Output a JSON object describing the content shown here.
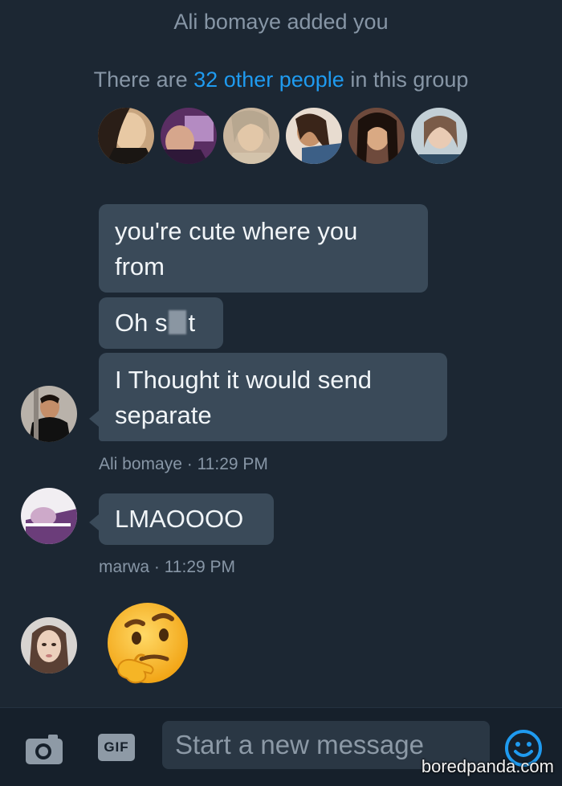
{
  "system": {
    "added_text": "Ali bomaye added you",
    "count_prefix": "There are ",
    "count_link": "32 other people",
    "count_suffix": " in this group"
  },
  "messages": [
    {
      "line1": "you're cute where you",
      "line2": "from"
    },
    {
      "prefix": "Oh s",
      "suffix": "t"
    },
    {
      "line1": "I Thought it would send",
      "line2": "separate"
    },
    {
      "text": "LMAOOOO"
    }
  ],
  "meta": [
    {
      "sender": "Ali bomaye",
      "sep": " · ",
      "time": "11:29 PM"
    },
    {
      "sender": "marwa",
      "sep": " · ",
      "time": "11:29 PM"
    }
  ],
  "composer": {
    "gif_label": "GIF",
    "placeholder": "Start a new message"
  },
  "icons": [
    "camera-icon",
    "gif-icon",
    "smiley-icon",
    "thinking-face-emoji"
  ],
  "colors": {
    "background": "#1c2733",
    "bubble": "#3a4a59",
    "link": "#1f9bf0",
    "muted_text": "#8796a6"
  },
  "watermark": "boredpanda.com"
}
